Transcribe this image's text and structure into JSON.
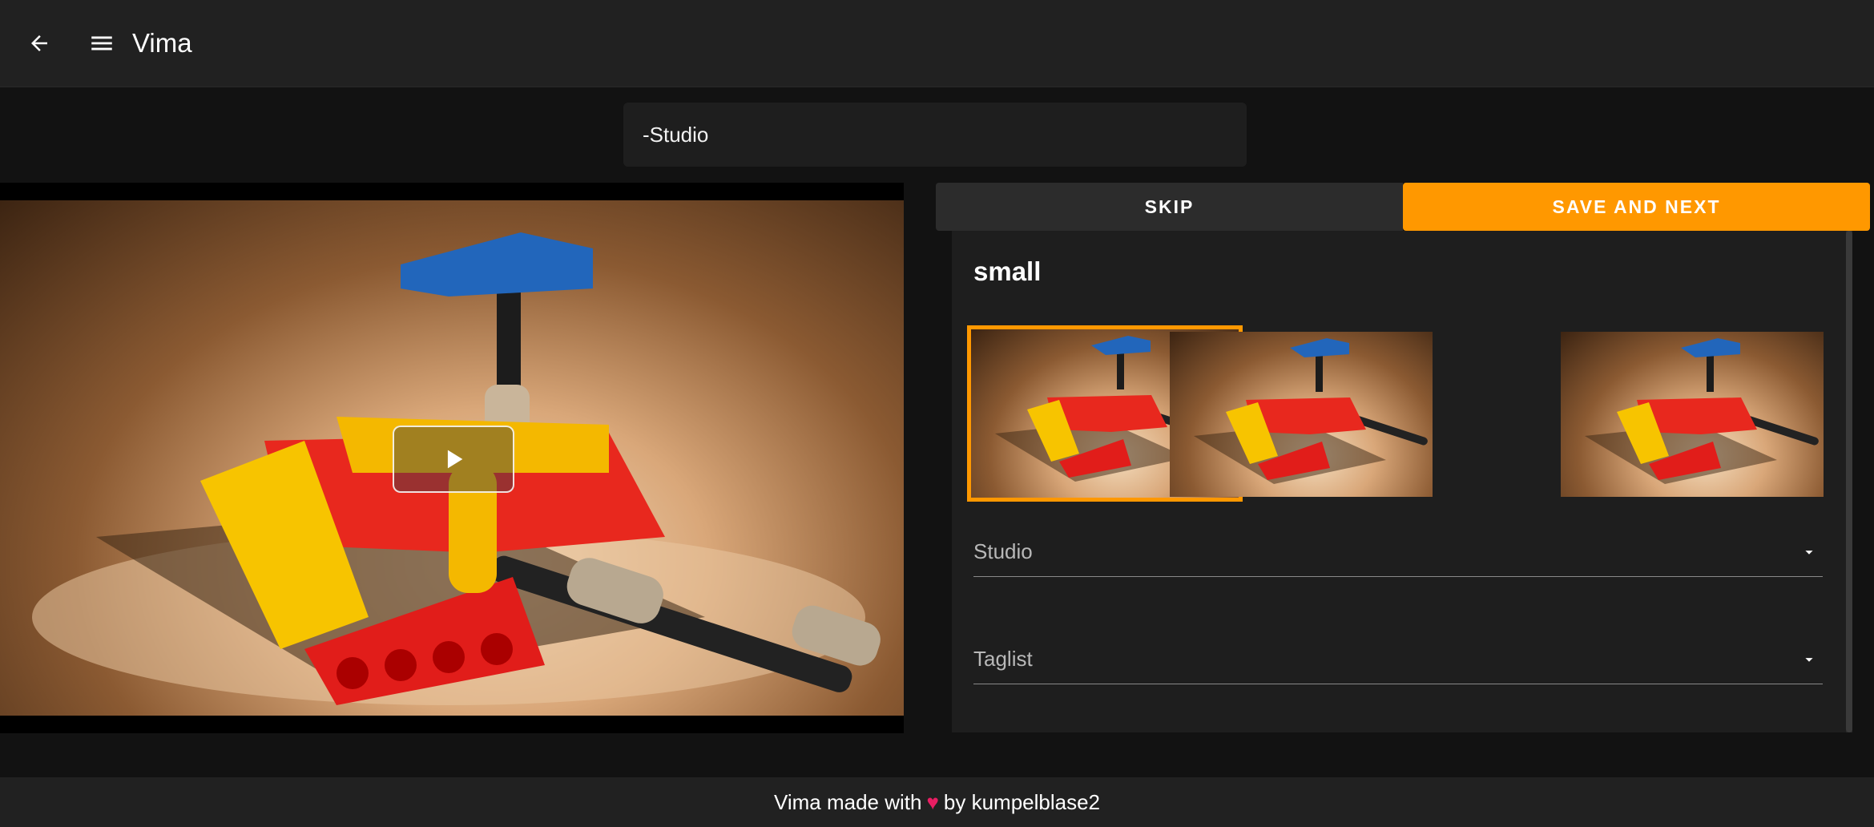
{
  "appbar": {
    "title": "Vima",
    "back_icon": "arrow-left-icon",
    "menu_icon": "menu-icon"
  },
  "search": {
    "value": "-Studio"
  },
  "video": {
    "play_icon": "play-icon"
  },
  "actions": {
    "skip_label": "SKIP",
    "save_label": "SAVE AND NEXT",
    "accent_color": "#ff9800"
  },
  "panel": {
    "section_title": "small",
    "thumbnails": [
      {
        "selected": true
      },
      {
        "selected": false
      },
      {
        "selected": false
      }
    ],
    "studio_label": "Studio",
    "taglist_label": "Taglist"
  },
  "footer": {
    "prefix": "Vima made with",
    "heart_icon": "heart-icon",
    "suffix": "by kumpelblase2",
    "heart_color": "#e91e63"
  }
}
